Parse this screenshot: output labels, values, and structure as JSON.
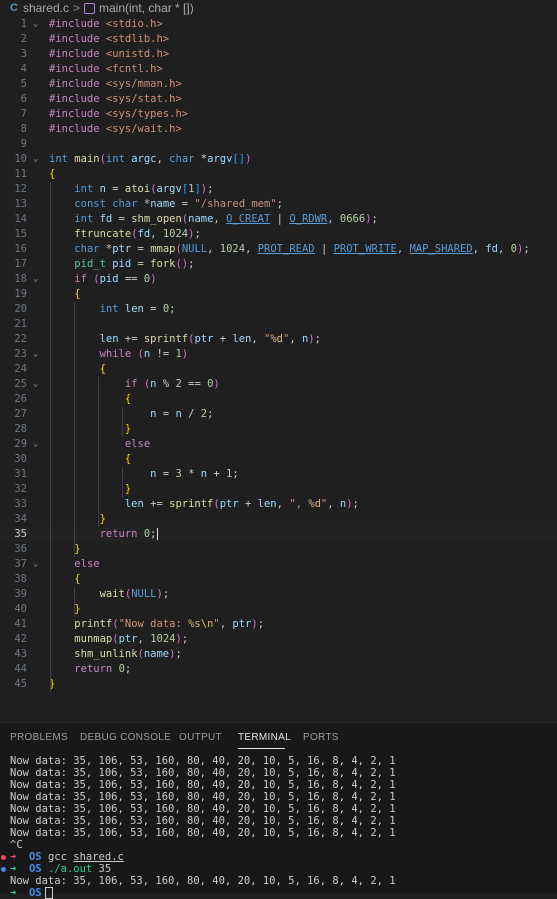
{
  "breadcrumb": {
    "file_icon": "C",
    "file": "shared.c",
    "separator": ">",
    "symbol": "main(int, char * [])"
  },
  "editor": {
    "current_line": 35,
    "lines": [
      {
        "n": "1",
        "text": "#include <stdio.h>"
      },
      {
        "n": "2",
        "text": "#include <stdlib.h>"
      },
      {
        "n": "3",
        "text": "#include <unistd.h>"
      },
      {
        "n": "4",
        "text": "#include <fcntl.h>"
      },
      {
        "n": "5",
        "text": "#include <sys/mman.h>"
      },
      {
        "n": "6",
        "text": "#include <sys/stat.h>"
      },
      {
        "n": "7",
        "text": "#include <sys/types.h>"
      },
      {
        "n": "8",
        "text": "#include <sys/wait.h>"
      },
      {
        "n": "9",
        "text": ""
      },
      {
        "n": "10",
        "text": "int main(int argc, char *argv[])"
      },
      {
        "n": "11",
        "text": "{"
      },
      {
        "n": "12",
        "text": "    int n = atoi(argv[1]);"
      },
      {
        "n": "13",
        "text": "    const char *name = \"/shared_mem\";"
      },
      {
        "n": "14",
        "text": "    int fd = shm_open(name, O_CREAT | O_RDWR, 0666);"
      },
      {
        "n": "15",
        "text": "    ftruncate(fd, 1024);"
      },
      {
        "n": "16",
        "text": "    char *ptr = mmap(NULL, 1024, PROT_READ | PROT_WRITE, MAP_SHARED, fd, 0);"
      },
      {
        "n": "17",
        "text": "    pid_t pid = fork();"
      },
      {
        "n": "18",
        "text": "    if (pid == 0)"
      },
      {
        "n": "19",
        "text": "    {"
      },
      {
        "n": "20",
        "text": "        int len = 0;"
      },
      {
        "n": "21",
        "text": ""
      },
      {
        "n": "22",
        "text": "        len += sprintf(ptr + len, \"%d\", n);"
      },
      {
        "n": "23",
        "text": "        while (n != 1)"
      },
      {
        "n": "24",
        "text": "        {"
      },
      {
        "n": "25",
        "text": "            if (n % 2 == 0)"
      },
      {
        "n": "26",
        "text": "            {"
      },
      {
        "n": "27",
        "text": "                n = n / 2;"
      },
      {
        "n": "28",
        "text": "            }"
      },
      {
        "n": "29",
        "text": "            else"
      },
      {
        "n": "30",
        "text": "            {"
      },
      {
        "n": "31",
        "text": "                n = 3 * n + 1;"
      },
      {
        "n": "32",
        "text": "            }"
      },
      {
        "n": "33",
        "text": "            len += sprintf(ptr + len, \", %d\", n);"
      },
      {
        "n": "34",
        "text": "        }"
      },
      {
        "n": "35",
        "text": "        return 0;"
      },
      {
        "n": "36",
        "text": "    }"
      },
      {
        "n": "37",
        "text": "    else"
      },
      {
        "n": "38",
        "text": "    {"
      },
      {
        "n": "39",
        "text": "        wait(NULL);"
      },
      {
        "n": "40",
        "text": "    }"
      },
      {
        "n": "41",
        "text": "    printf(\"Now data: %s\\n\", ptr);"
      },
      {
        "n": "42",
        "text": "    munmap(ptr, 1024);"
      },
      {
        "n": "43",
        "text": "    shm_unlink(name);"
      },
      {
        "n": "44",
        "text": "    return 0;"
      },
      {
        "n": "45",
        "text": "}"
      }
    ]
  },
  "panel": {
    "tabs": [
      {
        "label": "PROBLEMS"
      },
      {
        "label": "DEBUG CONSOLE"
      },
      {
        "label": "OUTPUT"
      },
      {
        "label": "TERMINAL",
        "active": true
      },
      {
        "label": "PORTS"
      }
    ]
  },
  "terminal": {
    "output_lines": [
      "Now data: 35, 106, 53, 160, 80, 40, 20, 10, 5, 16, 8, 4, 2, 1",
      "Now data: 35, 106, 53, 160, 80, 40, 20, 10, 5, 16, 8, 4, 2, 1",
      "Now data: 35, 106, 53, 160, 80, 40, 20, 10, 5, 16, 8, 4, 2, 1",
      "Now data: 35, 106, 53, 160, 80, 40, 20, 10, 5, 16, 8, 4, 2, 1",
      "Now data: 35, 106, 53, 160, 80, 40, 20, 10, 5, 16, 8, 4, 2, 1",
      "Now data: 35, 106, 53, 160, 80, 40, 20, 10, 5, 16, 8, 4, 2, 1",
      "Now data: 35, 106, 53, 160, 80, 40, 20, 10, 5, 16, 8, 4, 2, 1"
    ],
    "interrupt": "^C",
    "prompt_arrow": "➜",
    "prompt_dir": "OS",
    "cmd1_prog": "gcc",
    "cmd1_arg": "shared.c",
    "cmd2_prog": "./a.out",
    "cmd2_arg": "35",
    "result": "Now data: 35, 106, 53, 160, 80, 40, 20, 10, 5, 16, 8, 4, 2, 1",
    "colors": {
      "error_dot": "#f14c4c",
      "ok_dot": "#3b8eea",
      "ok_arrow": "#23d18b",
      "error_arrow": "#f14c4c"
    }
  }
}
